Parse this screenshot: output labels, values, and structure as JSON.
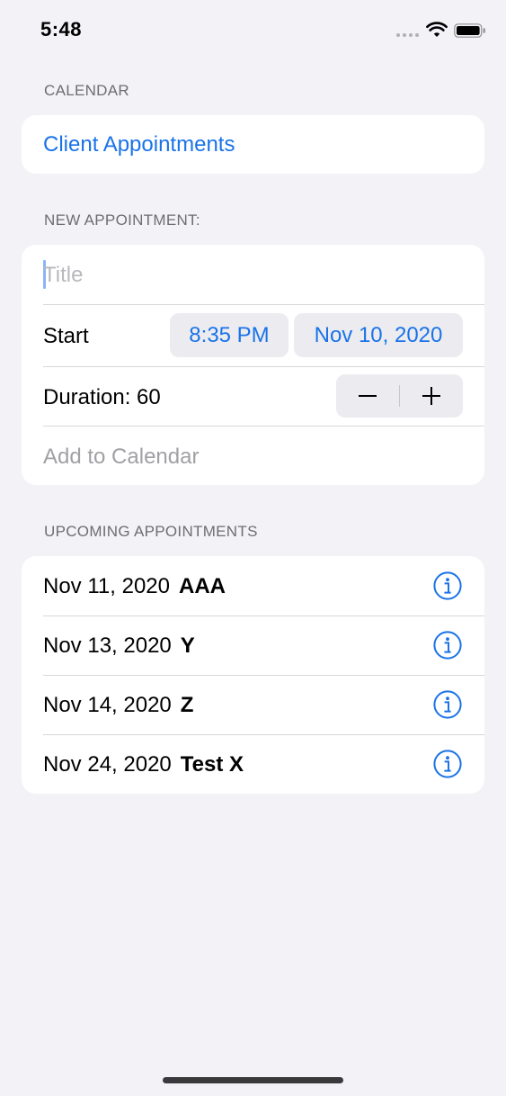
{
  "status_bar": {
    "time": "5:48"
  },
  "calendar_section": {
    "header": "CALENDAR",
    "calendar_name": "Client Appointments"
  },
  "new_appointment": {
    "header": "NEW APPOINTMENT:",
    "title_placeholder": "Title",
    "title_value": "",
    "start_label": "Start",
    "start_time": "8:35 PM",
    "start_date": "Nov 10, 2020",
    "duration_label": "Duration: 60",
    "add_label": "Add to Calendar"
  },
  "upcoming": {
    "header": "UPCOMING APPOINTMENTS",
    "items": [
      {
        "date": "Nov 11, 2020",
        "title": "AAA"
      },
      {
        "date": "Nov 13, 2020",
        "title": "Y"
      },
      {
        "date": "Nov 14, 2020",
        "title": "Z"
      },
      {
        "date": "Nov 24, 2020",
        "title": "Test X"
      }
    ]
  },
  "icons": {
    "wifi": "wifi-icon",
    "battery": "battery-icon",
    "info": "info-circle-icon",
    "minus": "minus-icon",
    "plus": "plus-icon"
  },
  "colors": {
    "accent": "#1a73e8",
    "background": "#f2f2f7",
    "card": "#ffffff",
    "secondary_text": "#6d6d72"
  }
}
